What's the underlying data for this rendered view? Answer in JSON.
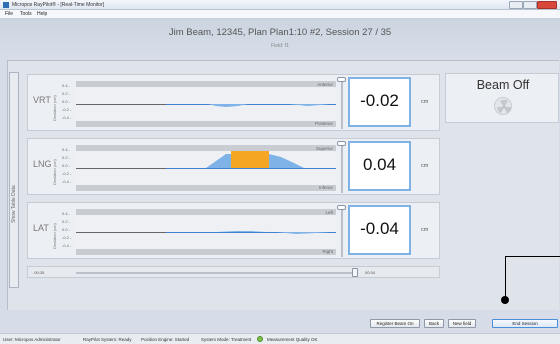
{
  "window": {
    "title": "Micropos RayPilot® - [Real-Time Monitor]"
  },
  "menu": {
    "items": [
      "File",
      "Tools",
      "Help"
    ]
  },
  "session": {
    "title": "Jim Beam, 12345, Plan Plan1:10 #2, Session 27 / 35",
    "field": "Field: f1"
  },
  "side_tab": {
    "label": "Show Table Data"
  },
  "units_label": "Deviation (cm)",
  "ticks": [
    "0.4 -",
    "0.2 -",
    "0.0 -",
    "-0.2 -",
    "-0.4 -"
  ],
  "axes": [
    {
      "name": "VRT",
      "top_dir": "Anterior",
      "bottom_dir": "Posterior",
      "value": "-0.02",
      "unit": "cm"
    },
    {
      "name": "LNG",
      "top_dir": "Superior",
      "bottom_dir": "Inferior",
      "value": "0.04",
      "unit": "cm"
    },
    {
      "name": "LAT",
      "top_dir": "Left",
      "bottom_dir": "Right",
      "value": "-0.04",
      "unit": "cm"
    }
  ],
  "beam_status": {
    "text": "Beam Off",
    "icon": "radiation-icon"
  },
  "timeline": {
    "start": "-00:35",
    "end": "00:34"
  },
  "buttons": {
    "register_beam_on": "Register Beam On",
    "back": "Back",
    "new_field": "New field",
    "end_session": "End Session"
  },
  "status": {
    "user": "User: Micropos Administrator",
    "system": "RayPilot System: Ready",
    "engine": "Position Engine: Started",
    "mode": "System Mode: Treatment",
    "quality": "Measurement Quality OK"
  },
  "colors": {
    "highlight": "#f5a623",
    "trace": "#3d7fd0",
    "value_border": "#7fb3e8",
    "quality_ok": "#7ec04a"
  }
}
